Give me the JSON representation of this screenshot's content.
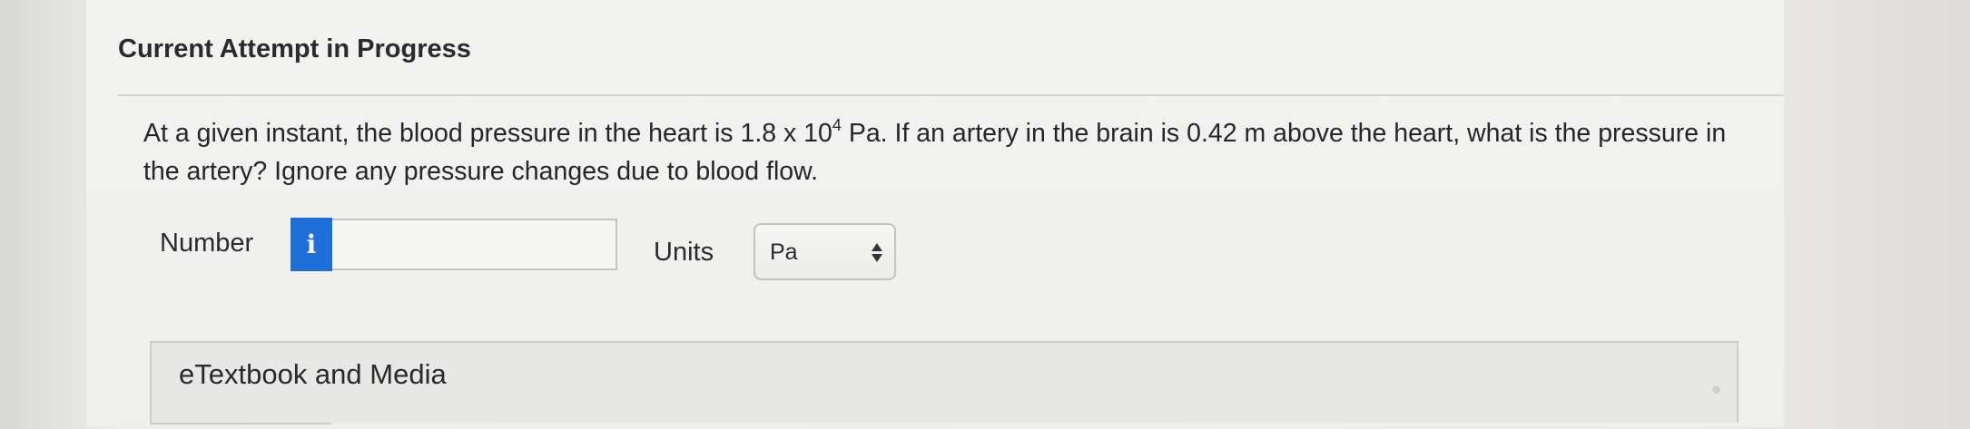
{
  "header": {
    "title": "Current Attempt in Progress"
  },
  "question": {
    "text_part1": "At a given instant, the blood pressure in the heart is 1.8 x 10",
    "exponent": "4",
    "text_part2": " Pa. If an artery in the brain is 0.42 m above the heart, what is the pressure in the artery? Ignore any pressure changes due to blood flow."
  },
  "answer": {
    "number_label": "Number",
    "info_icon": "i",
    "number_value": "",
    "units_label": "Units",
    "units_selected": "Pa"
  },
  "resources": {
    "etextbook_label": "eTextbook and Media"
  },
  "colors": {
    "info_button": "#1f6fd8",
    "background": "#efefed"
  }
}
